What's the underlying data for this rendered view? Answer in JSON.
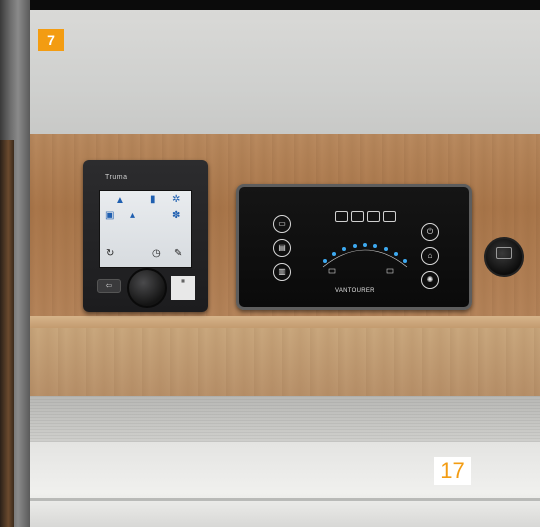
{
  "badges": {
    "section_number": "7",
    "page_number": "17"
  },
  "truma_panel": {
    "brand": "Truma",
    "back_symbol": "⇦",
    "screen_icons": [
      "flame-icon",
      "water-bottle-icon",
      "fan-icon",
      "lock-icon",
      "thermometer-icon",
      "snowflake-icon",
      "timer-icon",
      "clock-icon",
      "settings-icon"
    ]
  },
  "control_panel": {
    "brand": "VANTOURER",
    "left_buttons": [
      "battery-icon",
      "vehicle-battery-icon",
      "water-tank-icon"
    ],
    "right_buttons": [
      "power-icon",
      "pump-icon",
      "light-icon"
    ]
  },
  "colors": {
    "badge_orange": "#f39c12"
  }
}
